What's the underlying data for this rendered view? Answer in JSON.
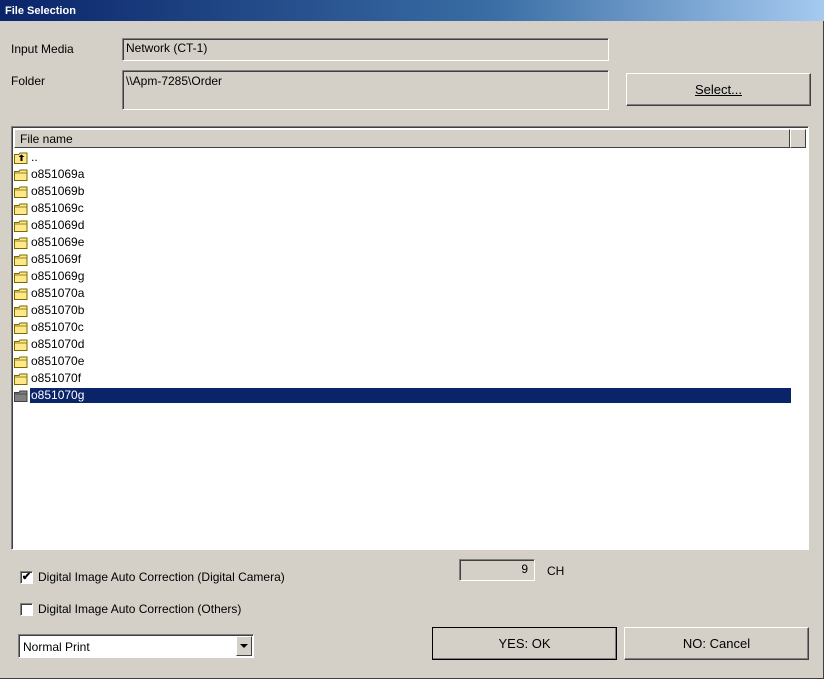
{
  "window": {
    "title": "File Selection"
  },
  "input_media": {
    "label": "Input Media",
    "value": "Network (CT-1)"
  },
  "folder": {
    "label": "Folder",
    "value": "\\\\Apm-7285\\Order"
  },
  "select_button": {
    "label": "Select..."
  },
  "file_list": {
    "header": "File name",
    "parent_label": "..",
    "items": [
      "o851069a",
      "o851069b",
      "o851069c",
      "o851069d",
      "o851069e",
      "o851069f",
      "o851069g",
      "o851070a",
      "o851070b",
      "o851070c",
      "o851070d",
      "o851070e",
      "o851070f",
      "o851070g"
    ],
    "selected": "o851070g"
  },
  "channel": {
    "value": "9",
    "unit": "CH"
  },
  "options": {
    "auto_correction_camera": {
      "label": "Digital Image Auto Correction (Digital Camera)",
      "checked": true
    },
    "auto_correction_others": {
      "label": "Digital Image Auto Correction (Others)",
      "checked": false
    }
  },
  "print_mode": {
    "value": "Normal Print"
  },
  "ok_button": {
    "label": "YES: OK"
  },
  "cancel_button": {
    "label": "NO: Cancel"
  },
  "colors": {
    "selection": "#0a246a",
    "folder": "#ffe88a",
    "background": "#d4d0c8"
  }
}
